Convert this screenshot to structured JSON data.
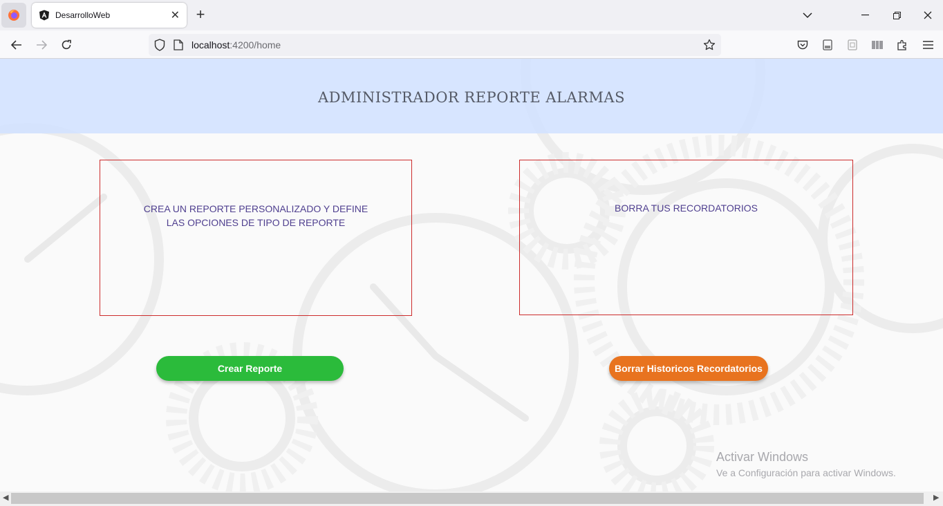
{
  "browser": {
    "tab_title": "DesarrolloWeb",
    "url_host": "localhost",
    "url_rest": ":4200/home"
  },
  "page": {
    "title": "ADMINISTRADOR REPORTE ALARMAS",
    "cards": [
      {
        "text": "CREA UN REPORTE PERSONALIZADO Y DEFINE LAS OPCIONES DE TIPO DE REPORTE"
      },
      {
        "text": "BORRA TUS RECORDATORIOS"
      }
    ],
    "buttons": {
      "create_label": "Crear Reporte",
      "delete_label": "Borrar Historicos Recordatorios"
    },
    "colors": {
      "header_band": "#d2e1ff",
      "card_border": "#cc2b2b",
      "create_button": "#2bbb3b",
      "delete_button": "#e8731f"
    }
  },
  "watermark": {
    "line1": "Activar Windows",
    "line2": "Ve a Configuración para activar Windows."
  }
}
